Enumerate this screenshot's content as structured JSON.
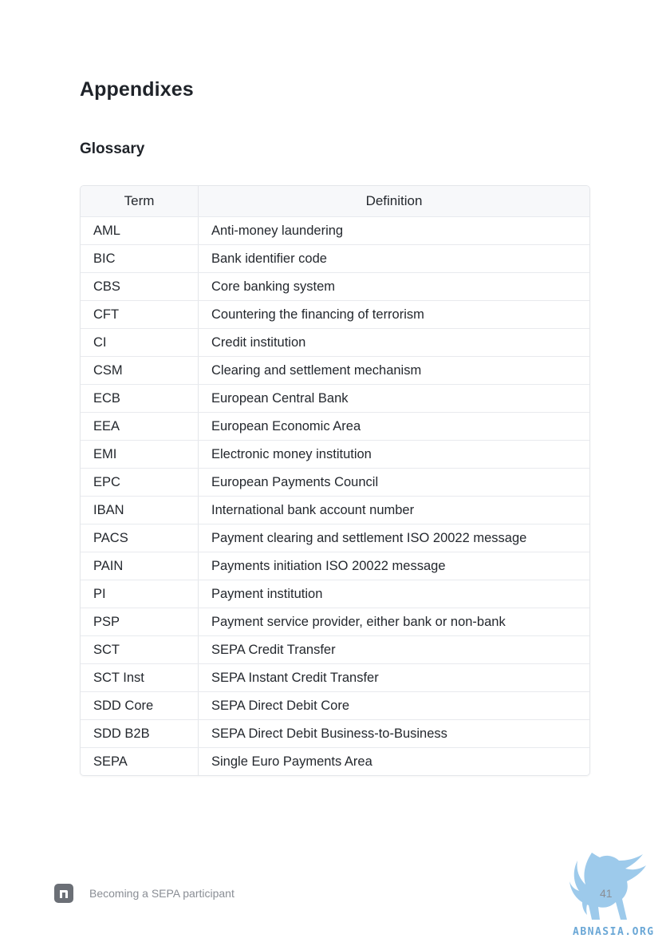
{
  "page": {
    "title": "Appendixes",
    "section_title": "Glossary"
  },
  "glossary": {
    "headers": {
      "term": "Term",
      "definition": "Definition"
    },
    "rows": [
      {
        "term": "AML",
        "definition": "Anti-money laundering"
      },
      {
        "term": "BIC",
        "definition": "Bank identifier code"
      },
      {
        "term": "CBS",
        "definition": "Core banking system"
      },
      {
        "term": "CFT",
        "definition": "Countering the financing of terrorism"
      },
      {
        "term": "CI",
        "definition": "Credit institution"
      },
      {
        "term": "CSM",
        "definition": "Clearing and settlement mechanism"
      },
      {
        "term": "ECB",
        "definition": "European Central Bank"
      },
      {
        "term": "EEA",
        "definition": "European Economic Area"
      },
      {
        "term": "EMI",
        "definition": "Electronic money institution"
      },
      {
        "term": "EPC",
        "definition": "European Payments Council"
      },
      {
        "term": "IBAN",
        "definition": "International bank account number"
      },
      {
        "term": "PACS",
        "definition": "Payment clearing and settlement ISO 20022 message"
      },
      {
        "term": "PAIN",
        "definition": "Payments initiation ISO 20022 message"
      },
      {
        "term": "PI",
        "definition": "Payment institution"
      },
      {
        "term": "PSP",
        "definition": "Payment service provider, either bank or non-bank"
      },
      {
        "term": "SCT",
        "definition": "SEPA Credit Transfer"
      },
      {
        "term": "SCT Inst",
        "definition": "SEPA Instant Credit Transfer"
      },
      {
        "term": "SDD Core",
        "definition": "SEPA Direct Debit Core"
      },
      {
        "term": "SDD B2B",
        "definition": "SEPA Direct Debit Business-to-Business"
      },
      {
        "term": "SEPA",
        "definition": "Single Euro Payments Area"
      }
    ]
  },
  "footer": {
    "logo_icon": "brand-n-logo-icon",
    "document_title": "Becoming a SEPA participant",
    "page_number": "41"
  },
  "watermark": {
    "icon": "griffin-watermark-icon",
    "text": "ABNASIA.ORG"
  },
  "colors": {
    "text": "#1f2329",
    "border": "#e4e6ea",
    "header_bg": "#f7f8fa",
    "footer_text": "#8a8e95",
    "watermark": "#6aa7d6"
  }
}
